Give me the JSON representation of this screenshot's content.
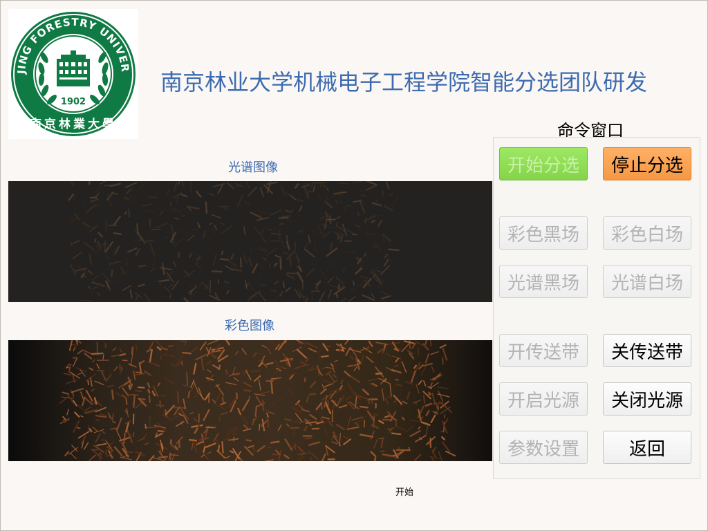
{
  "header": {
    "title": "南京林业大学机械电子工程学院智能分选团队研发",
    "logo": {
      "ring_text": "NANJING FORESTRY UNIVERSITY",
      "year": "1902",
      "seal_text": "南京林業大學",
      "color": "#0f7a44"
    }
  },
  "images": {
    "spectral_label": "光谱图像",
    "color_label": "彩色图像"
  },
  "command": {
    "title": "命令窗口",
    "buttons": {
      "start_sort": "开始分选",
      "stop_sort": "停止分选",
      "color_black": "彩色黑场",
      "color_white": "彩色白场",
      "spectral_black": "光谱黑场",
      "spectral_white": "光谱白场",
      "belt_on": "开传送带",
      "belt_off": "关传送带",
      "light_on": "开启光源",
      "light_off": "关闭光源",
      "params": "参数设置",
      "back": "返回"
    }
  },
  "status": {
    "text": "开始"
  },
  "colors": {
    "title_blue": "#3d6bb0",
    "start_green": "#8ddc52",
    "stop_orange": "#f9a150",
    "disabled_text": "#b3b3b3"
  }
}
